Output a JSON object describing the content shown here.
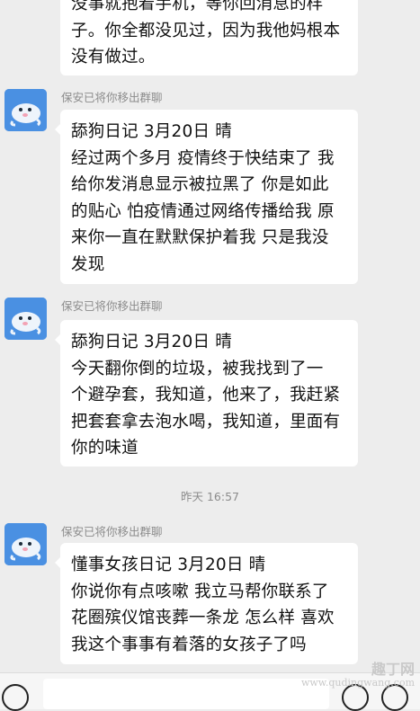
{
  "messages": [
    {
      "lines": [
        "没事就抱着手机，等你回消息的样",
        "子。你全都没见过，因为我他妈根本",
        "没有做过。"
      ]
    },
    {
      "sender": "保安已将你移出群聊",
      "lines": [
        "舔狗日记 3月20日 晴",
        "经过两个多月 疫情终于快结束了 我",
        "给你发消息显示被拉黑了 你是如此",
        "的贴心 怕疫情通过网络传播给我 原",
        "来你一直在默默保护着我 只是我没",
        "发现"
      ]
    },
    {
      "sender": "保安已将你移出群聊",
      "lines": [
        "舔狗日记 3月20日 晴",
        "今天翻你倒的垃圾，被我找到了一",
        "个避孕套，我知道，他来了，我赶紧",
        "把套套拿去泡水喝，我知道，里面有",
        "你的味道"
      ]
    },
    {
      "sender": "保安已将你移出群聊",
      "lines": [
        "懂事女孩日记 3月20日 晴",
        "你说你有点咳嗽 我立马帮你联系了",
        "花圈殡仪馆丧葬一条龙 怎么样 喜欢",
        "我这个事事有着落的女孩子了吗"
      ]
    }
  ],
  "time_divider": "昨天 16:57",
  "input_bar": {
    "voice_icon": "voice-icon",
    "emoji_icon": "emoji-icon",
    "plus_icon": "plus-icon"
  },
  "watermark": {
    "line1": "趣丁网",
    "line2": "www.qudingwang.com"
  },
  "colors": {
    "background": "#ededed",
    "bubble": "#ffffff",
    "avatar": "#4a90e2",
    "meta_text": "#8c8c8c"
  }
}
